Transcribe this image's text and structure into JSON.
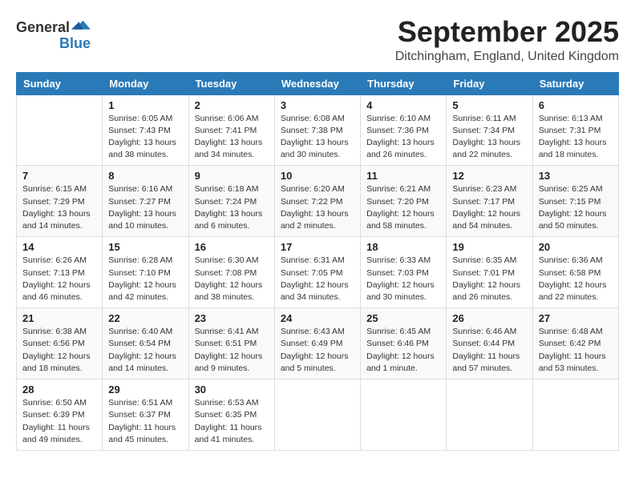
{
  "header": {
    "logo_general": "General",
    "logo_blue": "Blue",
    "month_title": "September 2025",
    "location": "Ditchingham, England, United Kingdom"
  },
  "weekdays": [
    "Sunday",
    "Monday",
    "Tuesday",
    "Wednesday",
    "Thursday",
    "Friday",
    "Saturday"
  ],
  "weeks": [
    [
      {
        "day": "",
        "info": ""
      },
      {
        "day": "1",
        "info": "Sunrise: 6:05 AM\nSunset: 7:43 PM\nDaylight: 13 hours\nand 38 minutes."
      },
      {
        "day": "2",
        "info": "Sunrise: 6:06 AM\nSunset: 7:41 PM\nDaylight: 13 hours\nand 34 minutes."
      },
      {
        "day": "3",
        "info": "Sunrise: 6:08 AM\nSunset: 7:38 PM\nDaylight: 13 hours\nand 30 minutes."
      },
      {
        "day": "4",
        "info": "Sunrise: 6:10 AM\nSunset: 7:36 PM\nDaylight: 13 hours\nand 26 minutes."
      },
      {
        "day": "5",
        "info": "Sunrise: 6:11 AM\nSunset: 7:34 PM\nDaylight: 13 hours\nand 22 minutes."
      },
      {
        "day": "6",
        "info": "Sunrise: 6:13 AM\nSunset: 7:31 PM\nDaylight: 13 hours\nand 18 minutes."
      }
    ],
    [
      {
        "day": "7",
        "info": "Sunrise: 6:15 AM\nSunset: 7:29 PM\nDaylight: 13 hours\nand 14 minutes."
      },
      {
        "day": "8",
        "info": "Sunrise: 6:16 AM\nSunset: 7:27 PM\nDaylight: 13 hours\nand 10 minutes."
      },
      {
        "day": "9",
        "info": "Sunrise: 6:18 AM\nSunset: 7:24 PM\nDaylight: 13 hours\nand 6 minutes."
      },
      {
        "day": "10",
        "info": "Sunrise: 6:20 AM\nSunset: 7:22 PM\nDaylight: 13 hours\nand 2 minutes."
      },
      {
        "day": "11",
        "info": "Sunrise: 6:21 AM\nSunset: 7:20 PM\nDaylight: 12 hours\nand 58 minutes."
      },
      {
        "day": "12",
        "info": "Sunrise: 6:23 AM\nSunset: 7:17 PM\nDaylight: 12 hours\nand 54 minutes."
      },
      {
        "day": "13",
        "info": "Sunrise: 6:25 AM\nSunset: 7:15 PM\nDaylight: 12 hours\nand 50 minutes."
      }
    ],
    [
      {
        "day": "14",
        "info": "Sunrise: 6:26 AM\nSunset: 7:13 PM\nDaylight: 12 hours\nand 46 minutes."
      },
      {
        "day": "15",
        "info": "Sunrise: 6:28 AM\nSunset: 7:10 PM\nDaylight: 12 hours\nand 42 minutes."
      },
      {
        "day": "16",
        "info": "Sunrise: 6:30 AM\nSunset: 7:08 PM\nDaylight: 12 hours\nand 38 minutes."
      },
      {
        "day": "17",
        "info": "Sunrise: 6:31 AM\nSunset: 7:05 PM\nDaylight: 12 hours\nand 34 minutes."
      },
      {
        "day": "18",
        "info": "Sunrise: 6:33 AM\nSunset: 7:03 PM\nDaylight: 12 hours\nand 30 minutes."
      },
      {
        "day": "19",
        "info": "Sunrise: 6:35 AM\nSunset: 7:01 PM\nDaylight: 12 hours\nand 26 minutes."
      },
      {
        "day": "20",
        "info": "Sunrise: 6:36 AM\nSunset: 6:58 PM\nDaylight: 12 hours\nand 22 minutes."
      }
    ],
    [
      {
        "day": "21",
        "info": "Sunrise: 6:38 AM\nSunset: 6:56 PM\nDaylight: 12 hours\nand 18 minutes."
      },
      {
        "day": "22",
        "info": "Sunrise: 6:40 AM\nSunset: 6:54 PM\nDaylight: 12 hours\nand 14 minutes."
      },
      {
        "day": "23",
        "info": "Sunrise: 6:41 AM\nSunset: 6:51 PM\nDaylight: 12 hours\nand 9 minutes."
      },
      {
        "day": "24",
        "info": "Sunrise: 6:43 AM\nSunset: 6:49 PM\nDaylight: 12 hours\nand 5 minutes."
      },
      {
        "day": "25",
        "info": "Sunrise: 6:45 AM\nSunset: 6:46 PM\nDaylight: 12 hours\nand 1 minute."
      },
      {
        "day": "26",
        "info": "Sunrise: 6:46 AM\nSunset: 6:44 PM\nDaylight: 11 hours\nand 57 minutes."
      },
      {
        "day": "27",
        "info": "Sunrise: 6:48 AM\nSunset: 6:42 PM\nDaylight: 11 hours\nand 53 minutes."
      }
    ],
    [
      {
        "day": "28",
        "info": "Sunrise: 6:50 AM\nSunset: 6:39 PM\nDaylight: 11 hours\nand 49 minutes."
      },
      {
        "day": "29",
        "info": "Sunrise: 6:51 AM\nSunset: 6:37 PM\nDaylight: 11 hours\nand 45 minutes."
      },
      {
        "day": "30",
        "info": "Sunrise: 6:53 AM\nSunset: 6:35 PM\nDaylight: 11 hours\nand 41 minutes."
      },
      {
        "day": "",
        "info": ""
      },
      {
        "day": "",
        "info": ""
      },
      {
        "day": "",
        "info": ""
      },
      {
        "day": "",
        "info": ""
      }
    ]
  ]
}
